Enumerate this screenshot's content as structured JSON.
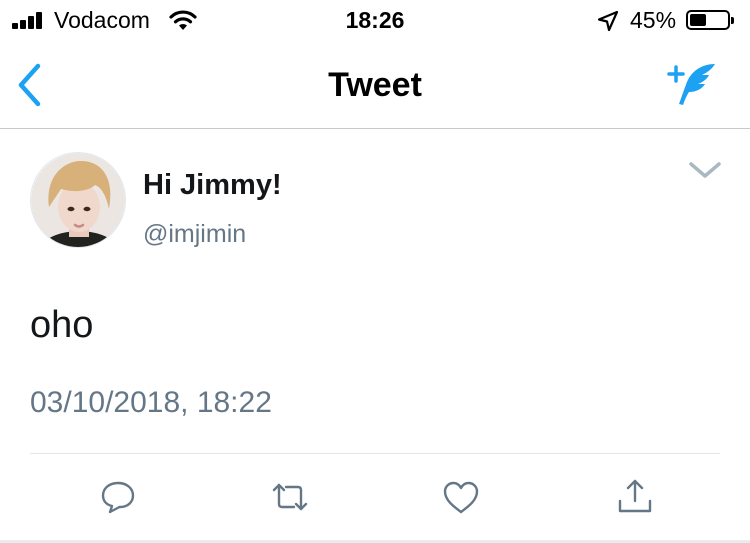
{
  "status_bar": {
    "carrier": "Vodacom",
    "time": "18:26",
    "battery_percent": "45%",
    "battery_level": 0.45
  },
  "nav": {
    "title": "Tweet",
    "back_icon": "chevron-left-icon",
    "compose_icon": "compose-feather-icon"
  },
  "tweet": {
    "display_name": "Hi Jimmy!",
    "handle": "@imjimin",
    "text": "oho",
    "timestamp": "03/10/2018, 18:22"
  },
  "actions": [
    {
      "name": "reply",
      "icon": "reply-icon"
    },
    {
      "name": "retweet",
      "icon": "retweet-icon"
    },
    {
      "name": "like",
      "icon": "heart-icon"
    },
    {
      "name": "share",
      "icon": "share-icon"
    }
  ],
  "colors": {
    "accent": "#1da1f2",
    "icon_gray": "#657786",
    "text": "#14171a",
    "divider": "#e1e8ed"
  }
}
